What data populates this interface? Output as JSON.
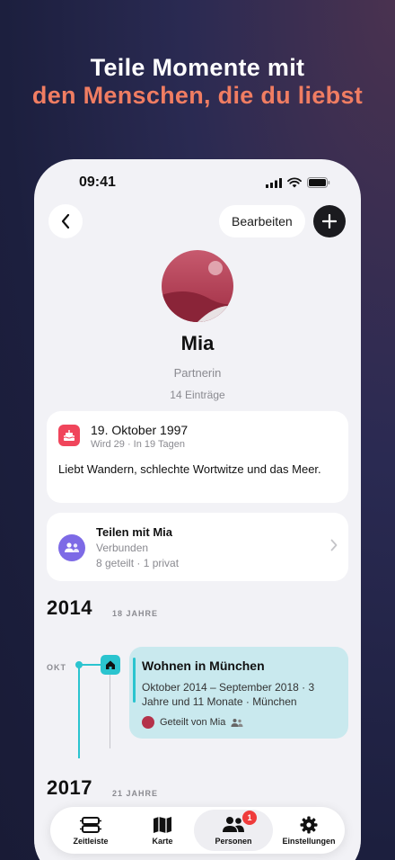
{
  "headline": {
    "line1": "Teile Momente mit",
    "line2": "den Menschen, die du liebst"
  },
  "status_bar": {
    "time": "09:41"
  },
  "header": {
    "edit_label": "Bearbeiten"
  },
  "profile": {
    "name": "Mia",
    "role": "Partnerin",
    "entries": "14 Einträge"
  },
  "birthday": {
    "date": "19. Oktober 1997",
    "subtitle": "Wird 29 · In 19 Tagen",
    "note": "Liebt Wandern, schlechte Wortwitze und das Meer."
  },
  "share": {
    "title": "Teilen mit Mia",
    "status": "Verbunden",
    "stats": "8 geteilt · 1 privat"
  },
  "timeline": [
    {
      "year": "2014",
      "ago": "18 JAHRE"
    },
    {
      "year": "2017",
      "ago": "21 JAHRE"
    }
  ],
  "event": {
    "month": "OKT",
    "title": "Wohnen in München",
    "detail": "Oktober 2014 – September 2018 · 3 Jahre und 11 Monate · München",
    "shared_by": "Geteilt von Mia"
  },
  "tabs": [
    {
      "label": "Zeitleiste",
      "icon": "timeline-icon"
    },
    {
      "label": "Karte",
      "icon": "map-icon"
    },
    {
      "label": "Personen",
      "icon": "people-icon",
      "badge": "1",
      "active": true
    },
    {
      "label": "Einstellungen",
      "icon": "gear-icon"
    }
  ],
  "colors": {
    "accent": "#2bc4cf",
    "headline_accent": "#f07d62",
    "birthday": "#f0455b",
    "share": "#7d6ae6",
    "badge": "#ef3b3b"
  }
}
